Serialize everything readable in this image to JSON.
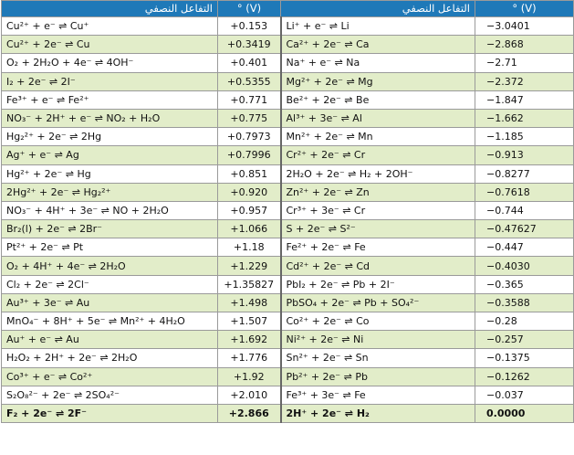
{
  "headers": {
    "reaction": "التفاعل النصفي",
    "potential": "° (V)"
  },
  "rows": [
    {
      "left": "Cu²⁺ + e⁻ ⇌ Cu⁺",
      "left_e": "+0.153",
      "right": "Li⁺ + e⁻ ⇌ Li",
      "right_e": "−3.0401"
    },
    {
      "left": "Cu²⁺ + 2e⁻ ⇌ Cu",
      "left_e": "+0.3419",
      "right": "Ca²⁺ + 2e⁻ ⇌ Ca",
      "right_e": "−2.868"
    },
    {
      "left": "O₂ + 2H₂O + 4e⁻ ⇌ 4OH⁻",
      "left_e": "+0.401",
      "right": "Na⁺ + e⁻ ⇌ Na",
      "right_e": "−2.71"
    },
    {
      "left": "I₂ + 2e⁻ ⇌ 2I⁻",
      "left_e": "+0.5355",
      "right": "Mg²⁺ + 2e⁻ ⇌ Mg",
      "right_e": "−2.372"
    },
    {
      "left": "Fe³⁺ + e⁻ ⇌ Fe²⁺",
      "left_e": "+0.771",
      "right": "Be²⁺ + 2e⁻ ⇌ Be",
      "right_e": "−1.847"
    },
    {
      "left": "NO₃⁻ + 2H⁺ + e⁻ ⇌ NO₂ + H₂O",
      "left_e": "+0.775",
      "right": "Al³⁺ + 3e⁻ ⇌ Al",
      "right_e": "−1.662"
    },
    {
      "left": "Hg₂²⁺ + 2e⁻ ⇌ 2Hg",
      "left_e": "+0.7973",
      "right": "Mn²⁺ + 2e⁻ ⇌ Mn",
      "right_e": "−1.185"
    },
    {
      "left": "Ag⁺ + e⁻ ⇌ Ag",
      "left_e": "+0.7996",
      "right": "Cr²⁺ + 2e⁻ ⇌ Cr",
      "right_e": "−0.913"
    },
    {
      "left": "Hg²⁺ + 2e⁻ ⇌ Hg",
      "left_e": "+0.851",
      "right": "2H₂O + 2e⁻ ⇌ H₂ + 2OH⁻",
      "right_e": "−0.8277"
    },
    {
      "left": "2Hg²⁺ + 2e⁻ ⇌ Hg₂²⁺",
      "left_e": "+0.920",
      "right": "Zn²⁺ + 2e⁻ ⇌ Zn",
      "right_e": "−0.7618"
    },
    {
      "left": "NO₃⁻ + 4H⁺ + 3e⁻ ⇌ NO + 2H₂O",
      "left_e": "+0.957",
      "right": "Cr³⁺ + 3e⁻ ⇌ Cr",
      "right_e": "−0.744"
    },
    {
      "left": "Br₂(l) + 2e⁻ ⇌ 2Br⁻",
      "left_e": "+1.066",
      "right": "S + 2e⁻ ⇌ S²⁻",
      "right_e": "−0.47627"
    },
    {
      "left": "Pt²⁺ + 2e⁻ ⇌ Pt",
      "left_e": "+1.18",
      "right": "Fe²⁺ + 2e⁻ ⇌ Fe",
      "right_e": "−0.447"
    },
    {
      "left": "O₂ + 4H⁺ + 4e⁻ ⇌ 2H₂O",
      "left_e": "+1.229",
      "right": "Cd²⁺ + 2e⁻ ⇌ Cd",
      "right_e": "−0.4030"
    },
    {
      "left": "Cl₂ + 2e⁻ ⇌ 2Cl⁻",
      "left_e": "+1.35827",
      "right": "PbI₂ + 2e⁻ ⇌ Pb + 2I⁻",
      "right_e": "−0.365"
    },
    {
      "left": "Au³⁺ + 3e⁻ ⇌ Au",
      "left_e": "+1.498",
      "right": "PbSO₄ + 2e⁻ ⇌ Pb + SO₄²⁻",
      "right_e": "−0.3588"
    },
    {
      "left": "MnO₄⁻ + 8H⁺ + 5e⁻ ⇌ Mn²⁺ + 4H₂O",
      "left_e": "+1.507",
      "right": "Co²⁺ + 2e⁻ ⇌ Co",
      "right_e": "−0.28"
    },
    {
      "left": "Au⁺ + e⁻ ⇌ Au",
      "left_e": "+1.692",
      "right": "Ni²⁺ + 2e⁻ ⇌ Ni",
      "right_e": "−0.257"
    },
    {
      "left": "H₂O₂ + 2H⁺ + 2e⁻ ⇌ 2H₂O",
      "left_e": "+1.776",
      "right": "Sn²⁺ + 2e⁻ ⇌ Sn",
      "right_e": "−0.1375"
    },
    {
      "left": "Co³⁺ + e⁻ ⇌ Co²⁺",
      "left_e": "+1.92",
      "right": "Pb²⁺ + 2e⁻ ⇌ Pb",
      "right_e": "−0.1262"
    },
    {
      "left": "S₂O₈²⁻ + 2e⁻ ⇌ 2SO₄²⁻",
      "left_e": "+2.010",
      "right": "Fe³⁺ + 3e⁻ ⇌ Fe",
      "right_e": "−0.037"
    },
    {
      "left": "F₂ + 2e⁻ ⇌ 2F⁻",
      "left_e": "+2.866",
      "right": "2H⁺ + 2e⁻ ⇌ H₂",
      "right_e": "0.0000"
    }
  ]
}
